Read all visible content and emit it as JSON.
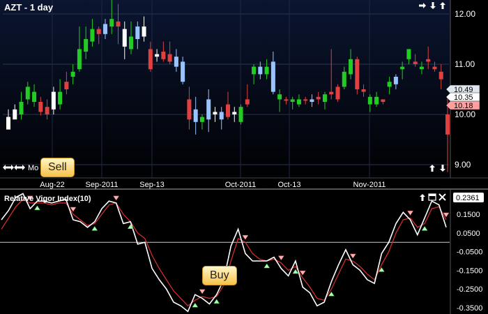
{
  "price_panel": {
    "title": "AZT - 1 day",
    "bottom_left_label": "Mo",
    "price_ticks": [
      "12.00",
      "11.00",
      "10.00",
      "9.00"
    ],
    "price_tags": [
      {
        "label": "10.49",
        "color": "#dfe6ee"
      },
      {
        "label": "10.35",
        "color": "#ffffff"
      },
      {
        "label": "10.18",
        "color": "#ff9f9f"
      }
    ],
    "date_labels": [
      "Aug-22",
      "Sep-2011",
      "Sep-13",
      "Oct-2011",
      "Oct-13",
      "Nov-2011"
    ],
    "controls": [
      "arrow-right-icon",
      "arrow-down-icon",
      "arrow-up-icon"
    ],
    "nav": [
      "double-arrow-left-icon",
      "double-arrow-right-icon"
    ],
    "bottom_controls": [
      "arrow-up-icon",
      "arrow-down-icon"
    ]
  },
  "indicator_panel": {
    "title": "Relative Vigor Index(10)",
    "current_value": "0.2361",
    "ticks": [
      "0.1500",
      "0.0500",
      "-0.0500",
      "-0.1500",
      "-0.2500",
      "-0.3500"
    ],
    "controls": [
      "arrow-up-icon",
      "window-icon",
      "close-icon"
    ]
  },
  "callouts": {
    "sell": "Sell",
    "buy": "Buy"
  },
  "colors": {
    "up_candle": "#22cc22",
    "down_candle": "#e04040",
    "light_candle": "#99c4ff",
    "white_candle": "#ffffff",
    "rvi_line": "#ffffff",
    "signal_line": "#e03030"
  },
  "chart_data": [
    {
      "type": "candlestick",
      "title": "AZT - 1 day",
      "ylim": [
        8.7,
        12.3
      ],
      "candles": [
        {
          "o": 9.95,
          "h": 10.1,
          "l": 9.85,
          "c": 9.7,
          "col": "W"
        },
        {
          "o": 10.1,
          "h": 10.2,
          "l": 9.95,
          "c": 9.9,
          "col": "W"
        },
        {
          "o": 10.0,
          "h": 10.45,
          "l": 9.9,
          "c": 10.25,
          "col": "G"
        },
        {
          "o": 10.3,
          "h": 10.65,
          "l": 10.2,
          "c": 10.55,
          "col": "G"
        },
        {
          "o": 10.25,
          "h": 10.6,
          "l": 10.15,
          "c": 10.45,
          "col": "G"
        },
        {
          "o": 10.25,
          "h": 10.35,
          "l": 9.98,
          "c": 10.05,
          "col": "R"
        },
        {
          "o": 10.15,
          "h": 10.3,
          "l": 9.9,
          "c": 10.0,
          "col": "R"
        },
        {
          "o": 10.1,
          "h": 10.55,
          "l": 10.0,
          "c": 10.45,
          "col": "W"
        },
        {
          "o": 10.2,
          "h": 10.7,
          "l": 10.1,
          "c": 10.45,
          "col": "G"
        },
        {
          "o": 10.5,
          "h": 10.85,
          "l": 10.4,
          "c": 10.65,
          "col": "R"
        },
        {
          "o": 10.75,
          "h": 11.0,
          "l": 10.6,
          "c": 10.85,
          "col": "G"
        },
        {
          "o": 10.9,
          "h": 11.75,
          "l": 10.85,
          "c": 11.3,
          "col": "G"
        },
        {
          "o": 11.25,
          "h": 11.75,
          "l": 11.1,
          "c": 11.5,
          "col": "G"
        },
        {
          "o": 11.45,
          "h": 11.9,
          "l": 11.35,
          "c": 11.7,
          "col": "G"
        },
        {
          "o": 11.6,
          "h": 11.75,
          "l": 11.4,
          "c": 11.7,
          "col": "R"
        },
        {
          "o": 11.6,
          "h": 11.9,
          "l": 11.5,
          "c": 11.8,
          "col": "L"
        },
        {
          "o": 11.75,
          "h": 12.35,
          "l": 11.6,
          "c": 11.9,
          "col": "G"
        },
        {
          "o": 11.85,
          "h": 12.2,
          "l": 11.4,
          "c": 11.75,
          "col": "R"
        },
        {
          "o": 11.7,
          "h": 11.85,
          "l": 11.1,
          "c": 11.35,
          "col": "W"
        },
        {
          "o": 11.3,
          "h": 11.85,
          "l": 11.2,
          "c": 11.55,
          "col": "G"
        },
        {
          "o": 11.5,
          "h": 11.85,
          "l": 11.3,
          "c": 11.75,
          "col": "L"
        },
        {
          "o": 11.75,
          "h": 11.95,
          "l": 11.45,
          "c": 11.55,
          "col": "W"
        },
        {
          "o": 11.3,
          "h": 11.45,
          "l": 10.85,
          "c": 10.9,
          "col": "R"
        },
        {
          "o": 11.15,
          "h": 11.3,
          "l": 11.05,
          "c": 11.2,
          "col": "W"
        },
        {
          "o": 11.25,
          "h": 11.45,
          "l": 11.05,
          "c": 11.1,
          "col": "R"
        },
        {
          "o": 11.2,
          "h": 11.45,
          "l": 11.0,
          "c": 11.05,
          "col": "R"
        },
        {
          "o": 10.95,
          "h": 11.3,
          "l": 10.85,
          "c": 11.15,
          "col": "L"
        },
        {
          "o": 11.05,
          "h": 11.15,
          "l": 10.6,
          "c": 10.65,
          "col": "L"
        },
        {
          "o": 10.3,
          "h": 10.55,
          "l": 9.7,
          "c": 9.9,
          "col": "R"
        },
        {
          "o": 10.1,
          "h": 10.35,
          "l": 9.6,
          "c": 9.85,
          "col": "L"
        },
        {
          "o": 9.85,
          "h": 10.0,
          "l": 9.7,
          "c": 9.95,
          "col": "G"
        },
        {
          "o": 9.9,
          "h": 10.5,
          "l": 9.65,
          "c": 10.3,
          "col": "L"
        },
        {
          "o": 10.0,
          "h": 10.15,
          "l": 9.85,
          "c": 10.05,
          "col": "W"
        },
        {
          "o": 10.05,
          "h": 10.15,
          "l": 9.7,
          "c": 9.9,
          "col": "L"
        },
        {
          "o": 10.2,
          "h": 10.45,
          "l": 9.9,
          "c": 9.95,
          "col": "R"
        },
        {
          "o": 10.0,
          "h": 10.15,
          "l": 9.85,
          "c": 10.05,
          "col": "W"
        },
        {
          "o": 9.85,
          "h": 10.2,
          "l": 9.8,
          "c": 10.15,
          "col": "G"
        },
        {
          "o": 10.2,
          "h": 10.6,
          "l": 10.15,
          "c": 10.3,
          "col": "R"
        },
        {
          "o": 10.8,
          "h": 11.0,
          "l": 10.6,
          "c": 10.95,
          "col": "G"
        },
        {
          "o": 10.95,
          "h": 11.05,
          "l": 10.7,
          "c": 10.8,
          "col": "L"
        },
        {
          "o": 10.8,
          "h": 11.1,
          "l": 10.7,
          "c": 10.95,
          "col": "G"
        },
        {
          "o": 11.05,
          "h": 11.25,
          "l": 10.4,
          "c": 10.45,
          "col": "L"
        },
        {
          "o": 10.4,
          "h": 10.5,
          "l": 10.05,
          "c": 10.3,
          "col": "G"
        },
        {
          "o": 10.3,
          "h": 10.35,
          "l": 10.2,
          "c": 10.28,
          "col": "R"
        },
        {
          "o": 10.25,
          "h": 10.35,
          "l": 10.1,
          "c": 10.3,
          "col": "G"
        },
        {
          "o": 10.3,
          "h": 10.4,
          "l": 10.15,
          "c": 10.2,
          "col": "G"
        },
        {
          "o": 10.3,
          "h": 10.35,
          "l": 10.2,
          "c": 10.28,
          "col": "R"
        },
        {
          "o": 10.25,
          "h": 10.4,
          "l": 10.15,
          "c": 10.3,
          "col": "L"
        },
        {
          "o": 10.3,
          "h": 10.45,
          "l": 10.2,
          "c": 10.35,
          "col": "R"
        },
        {
          "o": 10.25,
          "h": 10.45,
          "l": 10.1,
          "c": 10.4,
          "col": "G"
        },
        {
          "o": 10.4,
          "h": 11.3,
          "l": 10.3,
          "c": 10.45,
          "col": "R"
        },
        {
          "o": 10.3,
          "h": 10.6,
          "l": 10.25,
          "c": 10.55,
          "col": "R"
        },
        {
          "o": 10.55,
          "h": 10.95,
          "l": 10.5,
          "c": 10.85,
          "col": "G"
        },
        {
          "o": 10.8,
          "h": 11.3,
          "l": 10.7,
          "c": 11.1,
          "col": "G"
        },
        {
          "o": 11.1,
          "h": 11.15,
          "l": 10.4,
          "c": 10.5,
          "col": "R"
        },
        {
          "o": 10.5,
          "h": 10.6,
          "l": 10.35,
          "c": 10.45,
          "col": "R"
        },
        {
          "o": 10.2,
          "h": 10.4,
          "l": 10.05,
          "c": 10.35,
          "col": "G"
        },
        {
          "o": 10.35,
          "h": 10.45,
          "l": 10.15,
          "c": 10.2,
          "col": "G"
        },
        {
          "o": 10.25,
          "h": 10.3,
          "l": 10.2,
          "c": 10.3,
          "col": "R"
        },
        {
          "o": 10.55,
          "h": 10.75,
          "l": 10.4,
          "c": 10.65,
          "col": "G"
        },
        {
          "o": 10.6,
          "h": 10.8,
          "l": 10.5,
          "c": 10.75,
          "col": "L"
        },
        {
          "o": 10.9,
          "h": 11.05,
          "l": 10.7,
          "c": 10.95,
          "col": "G"
        },
        {
          "o": 11.1,
          "h": 11.3,
          "l": 11.0,
          "c": 11.3,
          "col": "G"
        },
        {
          "o": 11.05,
          "h": 11.2,
          "l": 10.95,
          "c": 11.0,
          "col": "R"
        },
        {
          "o": 10.95,
          "h": 11.05,
          "l": 10.8,
          "c": 10.9,
          "col": "G"
        },
        {
          "o": 11.05,
          "h": 11.35,
          "l": 10.9,
          "c": 11.1,
          "col": "R"
        },
        {
          "o": 10.95,
          "h": 11.05,
          "l": 10.85,
          "c": 10.9,
          "col": "R"
        },
        {
          "o": 10.85,
          "h": 11.0,
          "l": 10.5,
          "c": 10.7,
          "col": "R"
        },
        {
          "o": 10.0,
          "h": 10.35,
          "l": 8.85,
          "c": 9.6,
          "col": "R"
        }
      ]
    },
    {
      "type": "line",
      "title": "Relative Vigor Index(10)",
      "ylim": [
        -0.39,
        0.27
      ],
      "series": [
        {
          "name": "Relative Vigor Index(10)",
          "values": [
            0.12,
            0.17,
            0.24,
            0.26,
            0.18,
            0.22,
            0.22,
            0.21,
            0.22,
            0.23,
            0.12,
            0.11,
            0.08,
            0.11,
            0.18,
            0.22,
            0.21,
            0.1,
            0.11,
            -0.01,
            0.0,
            -0.14,
            -0.2,
            -0.25,
            -0.32,
            -0.34,
            -0.37,
            -0.28,
            -0.3,
            -0.33,
            -0.28,
            -0.2,
            -0.02,
            0.07,
            -0.06,
            -0.1,
            -0.1,
            -0.1,
            -0.08,
            -0.14,
            -0.18,
            -0.1,
            -0.24,
            -0.27,
            -0.34,
            -0.32,
            -0.21,
            -0.12,
            -0.04,
            -0.12,
            -0.15,
            -0.2,
            -0.22,
            -0.06,
            0.0,
            0.1,
            0.16,
            0.12,
            0.04,
            0.13,
            0.22,
            0.2,
            0.08
          ]
        },
        {
          "name": "Signal",
          "values": [
            0.07,
            0.13,
            0.19,
            0.23,
            0.21,
            0.21,
            0.21,
            0.2,
            0.21,
            0.21,
            0.15,
            0.12,
            0.09,
            0.1,
            0.15,
            0.2,
            0.21,
            0.15,
            0.11,
            0.05,
            0.02,
            -0.07,
            -0.14,
            -0.2,
            -0.26,
            -0.3,
            -0.34,
            -0.31,
            -0.29,
            -0.3,
            -0.29,
            -0.23,
            -0.1,
            0.02,
            0.0,
            -0.06,
            -0.09,
            -0.1,
            -0.09,
            -0.11,
            -0.15,
            -0.13,
            -0.19,
            -0.24,
            -0.3,
            -0.31,
            -0.25,
            -0.17,
            -0.09,
            -0.1,
            -0.13,
            -0.17,
            -0.2,
            -0.12,
            -0.05,
            0.05,
            0.12,
            0.13,
            0.08,
            0.1,
            0.18,
            0.19,
            0.12
          ]
        }
      ]
    }
  ]
}
